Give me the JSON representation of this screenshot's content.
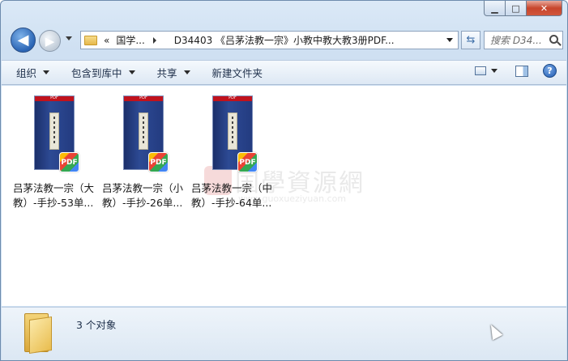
{
  "window": {
    "caption_min": "▁",
    "caption_max": "□",
    "caption_close": "✕"
  },
  "nav": {
    "back_glyph": "◀",
    "forward_glyph": "▶",
    "address_segments": [
      "«",
      "国学...",
      "D34403 《吕茅法教一宗》小教中教大教3册PDF..."
    ],
    "refresh_glyph": "⇆",
    "search_placeholder": "搜索 D34..."
  },
  "toolbar": {
    "organize": "组织",
    "include_library": "包含到库中",
    "share": "共享",
    "new_folder": "新建文件夹",
    "help": "?"
  },
  "files": [
    {
      "line1": "吕茅法教一宗（大",
      "line2": "教）-手抄-53单...",
      "badge": "PDF",
      "band": "PDF"
    },
    {
      "line1": "吕茅法教一宗（小",
      "line2": "教）-手抄-26单...",
      "badge": "PDF",
      "band": "PDF"
    },
    {
      "line1": "吕茅法教一宗（中",
      "line2": "教）-手抄-64单...",
      "badge": "PDF",
      "band": "PDF"
    }
  ],
  "watermark": {
    "text": "国學資源網",
    "sub": "www.guoxueziyuan.com"
  },
  "status": {
    "count_text": "3 个对象"
  },
  "colors": {
    "chrome": "#cfe0f2",
    "close_button": "#c7452c",
    "cover": "#2d4a94"
  }
}
